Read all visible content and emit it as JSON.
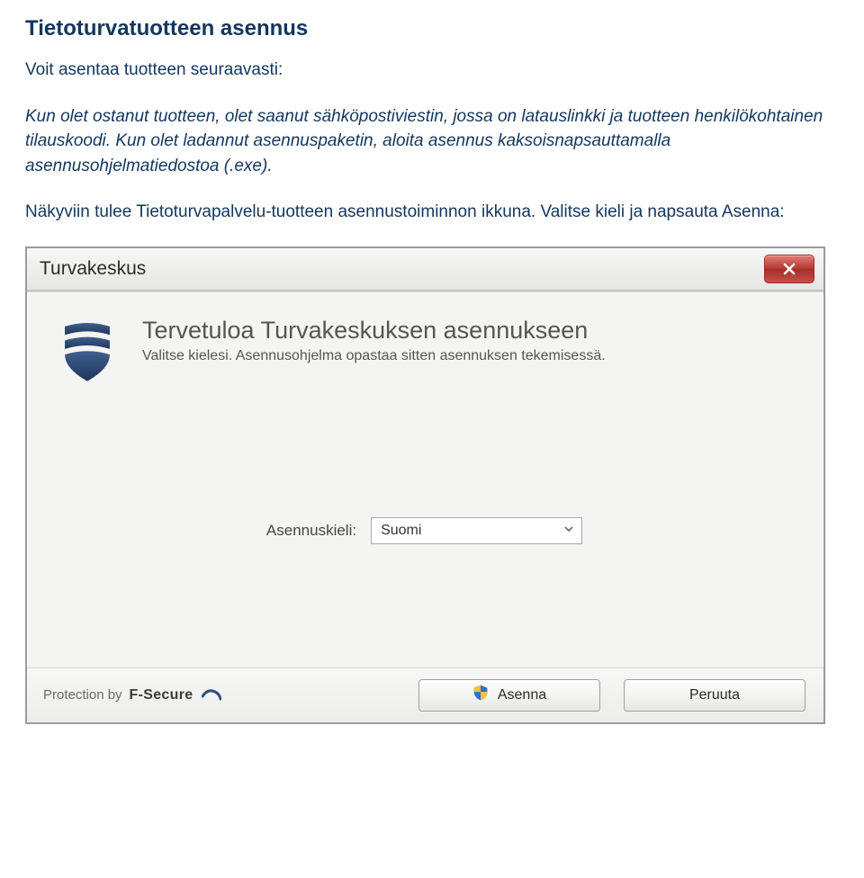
{
  "doc": {
    "heading": "Tietoturvatuotteen asennus",
    "subheading": "Voit asentaa tuotteen seuraavasti:",
    "paragraph1": "Kun olet ostanut tuotteen, olet saanut sähköpostiviestin, jossa on latauslinkki ja tuotteen henkilökohtainen tilauskoodi. Kun olet ladannut asennuspaketin, aloita asennus kaksoisnapsauttamalla asennusohjelmatiedostoa (.exe).",
    "paragraph2": "Näkyviin tulee Tietoturvapalvelu-tuotteen asennustoiminnon ikkuna. Valitse kieli ja napsauta Asenna:"
  },
  "installer": {
    "title": "Turvakeskus",
    "welcome_title": "Tervetuloa Turvakeskuksen asennukseen",
    "welcome_sub": "Valitse kielesi. Asennusohjelma opastaa sitten asennuksen tekemisessä.",
    "language_label": "Asennuskieli:",
    "language_value": "Suomi",
    "footer_protection_prefix": "Protection by",
    "footer_brand": "F-Secure",
    "install_button": "Asenna",
    "cancel_button": "Peruuta"
  }
}
